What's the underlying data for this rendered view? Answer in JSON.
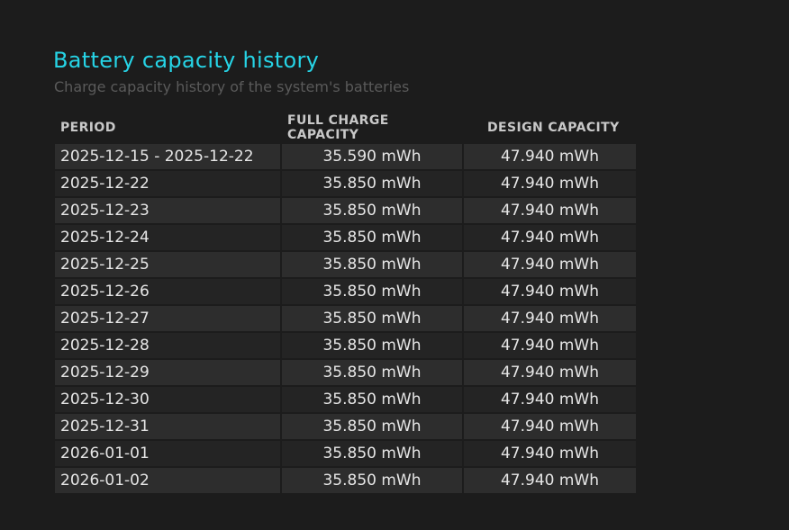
{
  "title": "Battery capacity history",
  "subtitle": "Charge capacity history of the system's batteries",
  "columns": [
    "PERIOD",
    "FULL CHARGE CAPACITY",
    "DESIGN CAPACITY"
  ],
  "rows": [
    {
      "period": "2025-12-15 - 2025-12-22",
      "full_charge": "35.590 mWh",
      "design": "47.940 mWh"
    },
    {
      "period": "2025-12-22",
      "full_charge": "35.850 mWh",
      "design": "47.940 mWh"
    },
    {
      "period": "2025-12-23",
      "full_charge": "35.850 mWh",
      "design": "47.940 mWh"
    },
    {
      "period": "2025-12-24",
      "full_charge": "35.850 mWh",
      "design": "47.940 mWh"
    },
    {
      "period": "2025-12-25",
      "full_charge": "35.850 mWh",
      "design": "47.940 mWh"
    },
    {
      "period": "2025-12-26",
      "full_charge": "35.850 mWh",
      "design": "47.940 mWh"
    },
    {
      "period": "2025-12-27",
      "full_charge": "35.850 mWh",
      "design": "47.940 mWh"
    },
    {
      "period": "2025-12-28",
      "full_charge": "35.850 mWh",
      "design": "47.940 mWh"
    },
    {
      "period": "2025-12-29",
      "full_charge": "35.850 mWh",
      "design": "47.940 mWh"
    },
    {
      "period": "2025-12-30",
      "full_charge": "35.850 mWh",
      "design": "47.940 mWh"
    },
    {
      "period": "2025-12-31",
      "full_charge": "35.850 mWh",
      "design": "47.940 mWh"
    },
    {
      "period": "2026-01-01",
      "full_charge": "35.850 mWh",
      "design": "47.940 mWh"
    },
    {
      "period": "2026-01-02",
      "full_charge": "35.850 mWh",
      "design": "47.940 mWh"
    }
  ],
  "colors": {
    "title": "#26d4e6",
    "subtitle": "#5a5a5a",
    "background": "#1c1c1c",
    "row_odd": "#2d2d2d",
    "row_even": "#242424",
    "header_text": "#c8c8c8",
    "cell_text": "#e6e6e6"
  }
}
